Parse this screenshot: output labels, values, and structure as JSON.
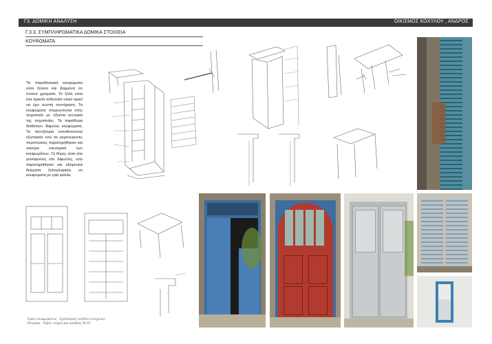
{
  "header": {
    "left": "Γ3. ΔΟΜΙΚΗ ΑΝΑΛΥΣΗ",
    "right": "ΟΙΚΙΣΜΟΣ ΚΟΧΥΛΟΥ , ΑΝΔΡΟΣ"
  },
  "section": {
    "title": "Γ.3.3. ΣΥΜΠΛΗΡΩΜΑΤΙΚΑ ΔΟΜΙΚΑ ΣΤΟΙΧΕΙΑ",
    "subtitle": "ΚΟΥΦΩΜΑΤΑ"
  },
  "body_text": "Τα παραδοσιακά κουφώματα είναι ξύλινα και βαμμένα σε έντονα χρώματα. Το ξύλο είναι ένα αρκετά ανθεκτικό υλικό αρκεί να έχει σωστή συντήρηση. Τα κουφώματα στερεώνονται στην τοιχοποιία με τζίνέτια κεντρικά της τοιχοποιίας. Τα παράθυρα διαθέτουν δίφυλλα κουφώματα. Τα παντζούρια τοποθετούνται εξωτερικά ενώ σε μεμονωμένες περιπτώσεις παρατηρήθηκαν και σκούρα εσωτερικά των κουφωμάτων. Οι θύρες είναι είτε μονόφυλλες είτε δίφυλλες, ενώ παρατηρήθηκαν και εξαιρετικά δείγματα ξυλογλυφικής σε κουφώματα με τρία φύλλα.",
  "sketch_caption": {
    "line1": "Όψεις κουφωμάτων - Σχεδιασμός εισόδου στοιχείων",
    "line2": "Κλίμακα - Πηγή: τεύχος και αριθμός 34-35"
  },
  "colors": {
    "header_bg": "#3a3a3a",
    "blue_door": "#4a7fb8",
    "red_door": "#b23a2e",
    "grey_door": "#c9ccce",
    "stone_wall": "#8a7e6c"
  }
}
